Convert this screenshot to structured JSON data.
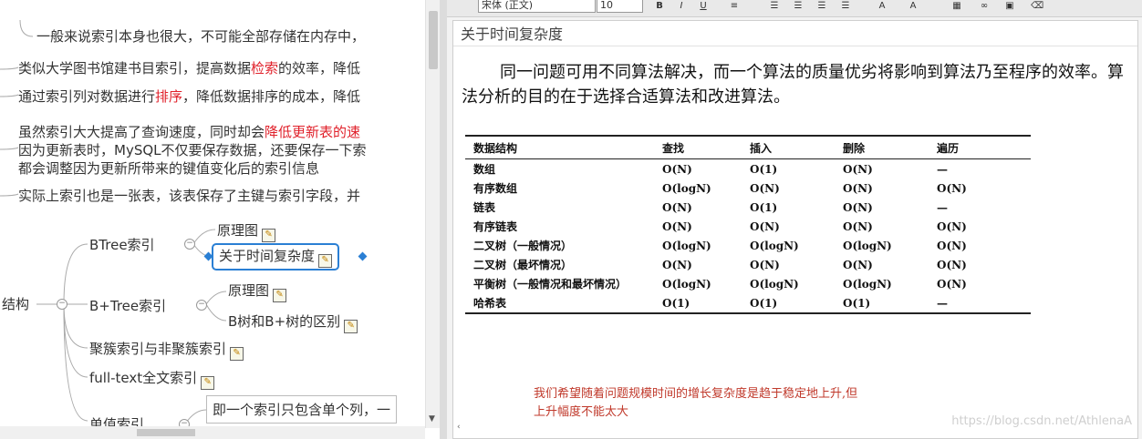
{
  "left_panel": {
    "lines": [
      "一般来说索引本身也很大，不可能全部存储在内存中，",
      "类似大学图书馆建书目索引，提高数据",
      "检索",
      "的效率，降低",
      "通过索引列对数据进行",
      "排序",
      "，降低数据排序的成本，降低",
      "虽然索引大大提高了查询速度，同时却会",
      "降低更新表的速",
      "因为更新表时，MySQL不仅要保存数据，还要保存一下索",
      "都会调整因为更新所带来的键值变化后的索引信息",
      "实际上索引也是一张表，该表保存了主键与索引字段，并"
    ],
    "tree": {
      "root": "结构",
      "btree": "BTree索引",
      "btree_children": [
        "原理图",
        "关于时间复杂度"
      ],
      "bplus": "B+Tree索引",
      "bplus_children": [
        "原理图",
        "B树和B+树的区别"
      ],
      "clustered": "聚簇索引与非聚簇索引",
      "fulltext": "full-text全文索引",
      "single": "单值索引",
      "single_note": "即一个索引只包含单个列，一"
    }
  },
  "toolbar": {
    "font_box": "宋体 (正文)",
    "size_box": "10"
  },
  "editor": {
    "title": "关于时间复杂度",
    "paragraph": "同一问题可用不同算法解决，而一个算法的质量优劣将影响到算法乃至程序的效率。算法分析的目的在于选择合适算法和改进算法。",
    "table_headers": [
      "数据结构",
      "查找",
      "插入",
      "删除",
      "遍历"
    ],
    "table_rows": [
      [
        "数组",
        "O(N)",
        "O(1)",
        "O(N)",
        "—"
      ],
      [
        "有序数组",
        "O(logN)",
        "O(N)",
        "O(N)",
        "O(N)"
      ],
      [
        "链表",
        "O(N)",
        "O(1)",
        "O(N)",
        "—"
      ],
      [
        "有序链表",
        "O(N)",
        "O(N)",
        "O(N)",
        "O(N)"
      ],
      [
        "二叉树（一般情况）",
        "O(logN)",
        "O(logN)",
        "O(logN)",
        "O(N)"
      ],
      [
        "二叉树（最坏情况）",
        "O(N)",
        "O(N)",
        "O(N)",
        "O(N)"
      ],
      [
        "平衡树（一般情况和最坏情况）",
        "O(logN)",
        "O(logN)",
        "O(logN)",
        "O(N)"
      ],
      [
        "哈希表",
        "O(1)",
        "O(1)",
        "O(1)",
        "—"
      ]
    ],
    "red_note_1": "我们希望随着问题规模时间的增长复杂度是趋于稳定地上升,但",
    "red_note_2": "上升幅度不能太大",
    "watermark": "https://blog.csdn.net/AthlenaA"
  },
  "colors": {
    "accent_blue": "#2a7fd4",
    "red_text": "#e0202a",
    "note_red": "#c0392b"
  }
}
